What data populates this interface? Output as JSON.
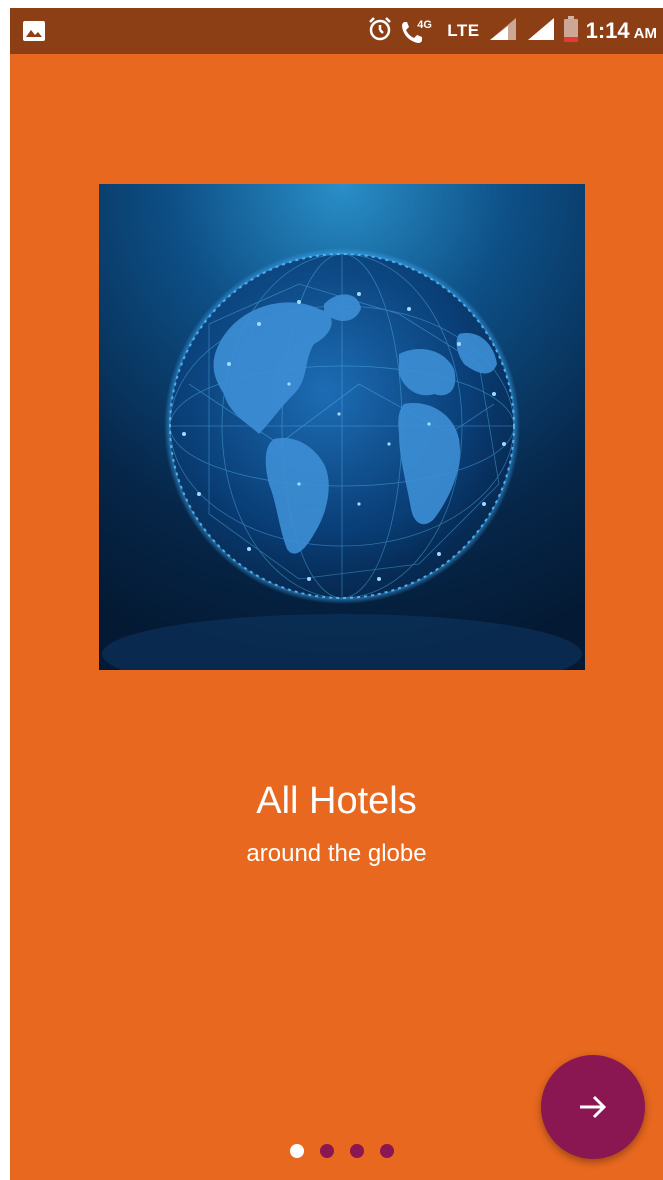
{
  "status_bar": {
    "network_label": "4G",
    "lte_label": "LTE",
    "time": "1:14",
    "ampm": "AM"
  },
  "onboarding": {
    "title": "All Hotels",
    "subtitle": "around the globe",
    "page_count": 4,
    "current_page": 1
  },
  "colors": {
    "background": "#E8681F",
    "status_bar": "#8C3E14",
    "accent": "#8A1652",
    "text": "#FFFFFF"
  },
  "icons": {
    "status_left": "image-icon",
    "alarm": "alarm-clock-icon",
    "call": "wifi-calling-icon",
    "signal_1": "signal-icon",
    "signal_2": "signal-icon",
    "battery": "battery-icon",
    "fab": "arrow-right-icon"
  }
}
